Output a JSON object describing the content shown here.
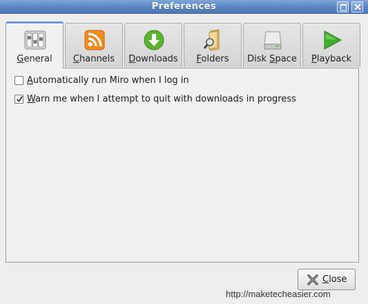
{
  "window": {
    "title": "Preferences",
    "maximize_icon": "maximize-icon",
    "close_icon": "window-close-icon"
  },
  "tabs": [
    {
      "label": "General",
      "icon": "switches-icon",
      "active": true
    },
    {
      "label": "Channels",
      "icon": "rss-feed-icon",
      "active": false
    },
    {
      "label": "Downloads",
      "icon": "download-arrow-icon",
      "active": false
    },
    {
      "label": "Folders",
      "icon": "folder-search-icon",
      "active": false
    },
    {
      "label": "Disk Space",
      "icon": "hard-drive-icon",
      "active": false
    },
    {
      "label": "Playback",
      "icon": "play-icon",
      "active": false
    }
  ],
  "options": [
    {
      "label": "Automatically run Miro when I log in",
      "checked": false
    },
    {
      "label": "Warn me when I attempt to quit with downloads in progress",
      "checked": true
    }
  ],
  "footer": {
    "close_label": "Close",
    "watermark": "http://maketecheasier.com"
  },
  "colors": {
    "titlebar": "#5b85c1",
    "rss": "#f28b1f",
    "download": "#5bb32e",
    "play": "#3fae2a"
  }
}
